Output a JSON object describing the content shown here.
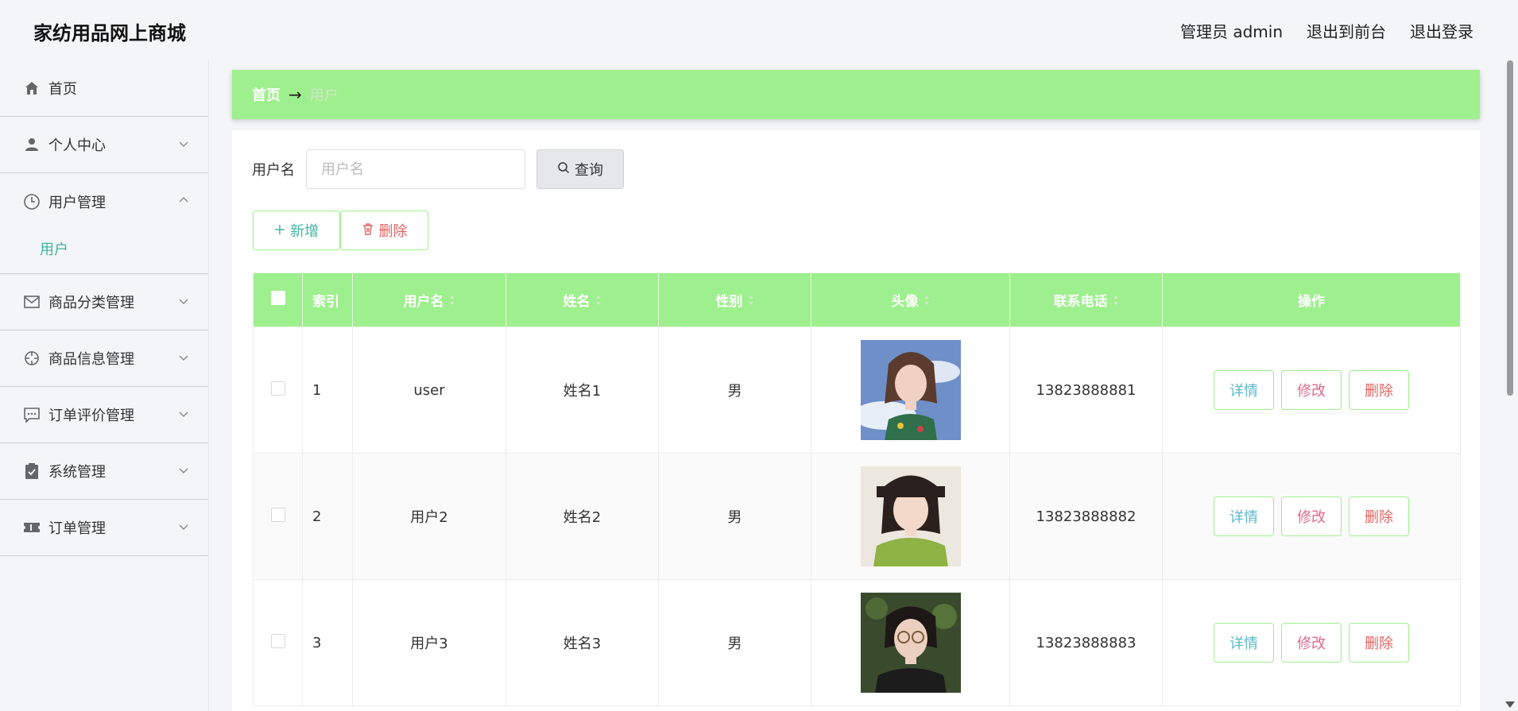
{
  "header": {
    "brand": "家纺用品网上商城",
    "admin_label": "管理员 admin",
    "to_front": "退出到前台",
    "logout": "退出登录"
  },
  "sidebar": {
    "items": [
      {
        "label": "首页",
        "icon": "home-icon"
      },
      {
        "label": "个人中心",
        "icon": "person-icon"
      },
      {
        "label": "用户管理",
        "icon": "clock-icon",
        "expanded": true,
        "children": [
          {
            "label": "用户"
          }
        ]
      },
      {
        "label": "商品分类管理",
        "icon": "mail-icon"
      },
      {
        "label": "商品信息管理",
        "icon": "crosshair-icon"
      },
      {
        "label": "订单评价管理",
        "icon": "chat-icon"
      },
      {
        "label": "系统管理",
        "icon": "clipboard-icon"
      },
      {
        "label": "订单管理",
        "icon": "ticket-icon"
      }
    ]
  },
  "breadcrumb": {
    "home": "首页",
    "arrow": "→",
    "current": "用户"
  },
  "search": {
    "label": "用户名",
    "placeholder": "用户名",
    "value": "",
    "button": "查询"
  },
  "actions": {
    "add": "新增",
    "delete": "删除"
  },
  "table": {
    "columns": [
      "索引",
      "用户名",
      "姓名",
      "性别",
      "头像",
      "联系电话",
      "操作"
    ],
    "rows": [
      {
        "index": "1",
        "username": "user",
        "name": "姓名1",
        "gender": "男",
        "phone": "13823888881"
      },
      {
        "index": "2",
        "username": "用户2",
        "name": "姓名2",
        "gender": "男",
        "phone": "13823888882"
      },
      {
        "index": "3",
        "username": "用户3",
        "name": "姓名3",
        "gender": "男",
        "phone": "13823888883"
      }
    ],
    "ops": {
      "detail": "详情",
      "edit": "修改",
      "delete": "删除"
    }
  },
  "colors": {
    "accent": "#9eef8d",
    "teal": "#3fb6a0",
    "danger": "#e06464"
  }
}
